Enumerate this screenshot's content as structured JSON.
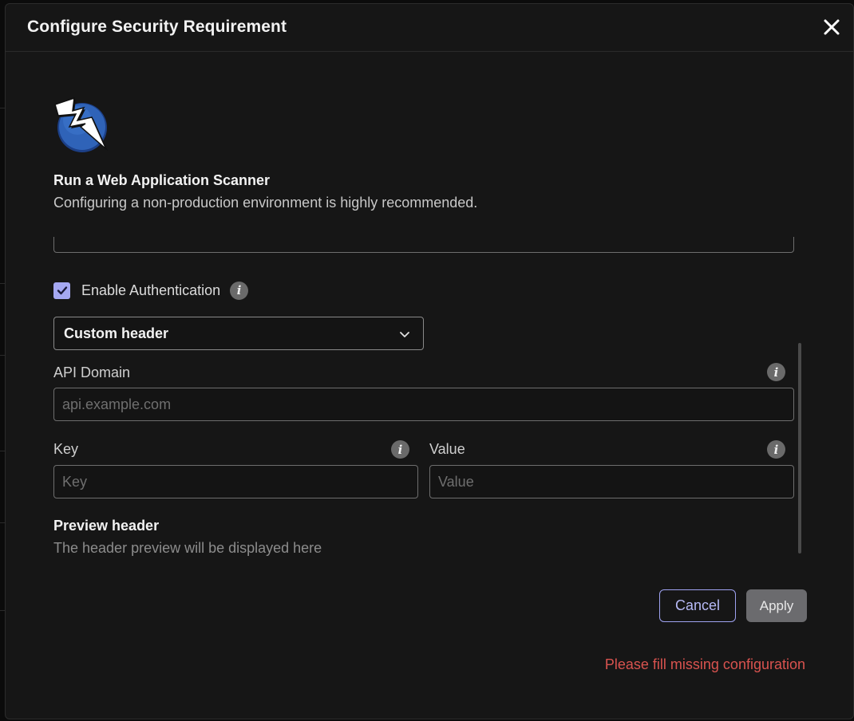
{
  "modal": {
    "title": "Configure Security Requirement"
  },
  "scanner": {
    "title": "Run a Web Application Scanner",
    "subtitle": "Configuring a non-production environment is highly recommended."
  },
  "auth": {
    "checkbox_checked": true,
    "label": "Enable Authentication",
    "method_selected": "Custom header"
  },
  "fields": {
    "api_domain": {
      "label": "API Domain",
      "placeholder": "api.example.com",
      "value": ""
    },
    "key": {
      "label": "Key",
      "placeholder": "Key",
      "value": ""
    },
    "value": {
      "label": "Value",
      "placeholder": "Value",
      "value": ""
    }
  },
  "preview": {
    "title": "Preview header",
    "placeholder": "The header preview will be displayed here"
  },
  "actions": {
    "cancel_label": "Cancel",
    "apply_label": "Apply"
  },
  "error": {
    "message": "Please fill missing configuration"
  },
  "colors": {
    "accent": "#a5a8f2",
    "error": "#d9534f",
    "logo_blue": "#2f63b8"
  }
}
